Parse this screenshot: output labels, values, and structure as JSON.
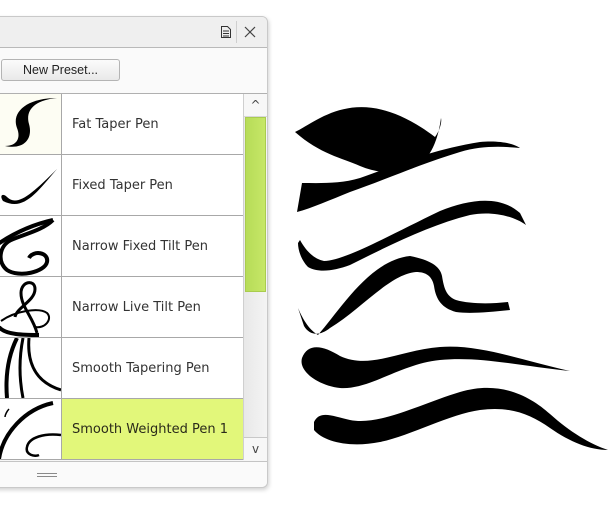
{
  "panel": {
    "titlebar": {
      "menu_icon": "panel-menu-icon",
      "close_icon": "close-icon",
      "close_glyph": "✕"
    },
    "toolbar": {
      "new_preset_label": "New Preset..."
    },
    "presets": [
      {
        "name": "Fat Taper Pen",
        "thumbnail": "fat-taper-stroke",
        "selected": false
      },
      {
        "name": "Fixed Taper Pen",
        "thumbnail": "fixed-taper-stroke",
        "selected": false
      },
      {
        "name": "Narrow Fixed Tilt Pen",
        "thumbnail": "narrow-fixed-tilt-stroke",
        "selected": false
      },
      {
        "name": "Narrow Live Tilt Pen",
        "thumbnail": "narrow-live-tilt-stroke",
        "selected": false
      },
      {
        "name": "Smooth Tapering Pen",
        "thumbnail": "smooth-tapering-stroke",
        "selected": false
      },
      {
        "name": "Smooth Weighted Pen 1",
        "thumbnail": "smooth-weighted-stroke",
        "selected": true
      }
    ],
    "scrollbar": {
      "up_glyph": "^",
      "down_glyph": "v",
      "thumb_color": "#bfe15f"
    },
    "selected_color": "#e2f77a"
  },
  "canvas": {
    "strokes": [
      "fat-taper-stroke",
      "fixed-taper-stroke",
      "narrow-fixed-tilt-stroke",
      "narrow-live-tilt-stroke",
      "smooth-tapering-stroke",
      "smooth-weighted-stroke"
    ]
  }
}
